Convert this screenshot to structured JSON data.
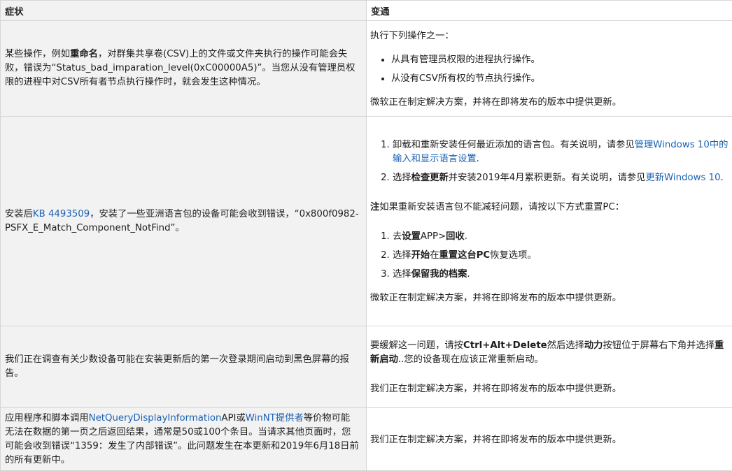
{
  "headers": {
    "symptom": "症状",
    "workaround": "变通"
  },
  "rows": [
    {
      "symptom": {
        "p1": "某些操作，例如",
        "b1": "重命名",
        "p2": "，对群集共享卷(CSV)上的文件或文件夹执行的操作可能会失败，错误为“Status_bad_imparation_level(0xC00000A5)”。当您从没有管理员权限的进程中对CSV所有者节点执行操作时，就会发生这种情况。"
      },
      "workaround": {
        "intro": "执行下列操作之一：",
        "bullets": [
          "从具有管理员权限的进程执行操作。",
          "从没有CSV所有权的节点执行操作。"
        ],
        "footer": "微软正在制定解决方案，并将在即将发布的版本中提供更新。"
      }
    },
    {
      "symptom": {
        "p1": "安装后",
        "link": "KB 4493509",
        "p2": "，安装了一些亚洲语言包的设备可能会收到错误，“0x800f0982-PSFX_E_Match_Component_NotFind”。"
      },
      "workaround": {
        "step1_text": "卸载和重新安装任何最近添加的语言包。有关说明，请参见",
        "step1_link": "管理Windows 10中的输入和显示语言设置",
        "step1_end": ".",
        "step2_pre": "选择",
        "step2_bold": "检查更新",
        "step2_text": "并安装2019年4月累积更新。有关说明，请参见",
        "step2_link": "更新Windows 10",
        "step2_end": ".",
        "note_bold": "注",
        "note_text": "如果重新安装语言包不能减轻问题，请按以下方式重置PC：",
        "reset1_pre": "去",
        "reset1_b1": "设置",
        "reset1_mid": "APP>",
        "reset1_b2": "回收",
        "reset1_end": ".",
        "reset2_pre": "选择",
        "reset2_b1": "开始",
        "reset2_mid": "在",
        "reset2_b2": "重置这台PC",
        "reset2_end": "恢复选项。",
        "reset3_pre": "选择",
        "reset3_b1": "保留我的档案",
        "reset3_end": ".",
        "footer": "微软正在制定解决方案，并将在即将发布的版本中提供更新。"
      }
    },
    {
      "symptom": {
        "text": "我们正在调查有关少数设备可能在安装更新后的第一次登录期间启动到黑色屏幕的报告。"
      },
      "workaround": {
        "p1": "要缓解这一问题，请按",
        "b1": "Ctrl+Alt+Delete",
        "p2": "然后选择",
        "b2": "动力",
        "p3": "按钮位于屏幕右下角并选择",
        "b3": "重新启动",
        "p4": "..您的设备现在应该正常重新启动。",
        "footer": "我们正在制定解决方案，并将在即将发布的版本中提供更新。"
      }
    },
    {
      "symptom": {
        "p1": "应用程序和脚本调用",
        "link1": "NetQueryDisplayInformation",
        "p2": "API或",
        "link2": "WinNT提供者",
        "p3": "等价物可能无法在数据的第一页之后返回结果，通常是50或100个条目。当请求其他页面时，您可能会收到错误“1359：发生了内部错误”。此问题发生在本更新和2019年6月18日前的所有更新中。"
      },
      "workaround": {
        "footer": "我们正在制定解决方案，并将在即将发布的版本中提供更新。"
      }
    }
  ]
}
